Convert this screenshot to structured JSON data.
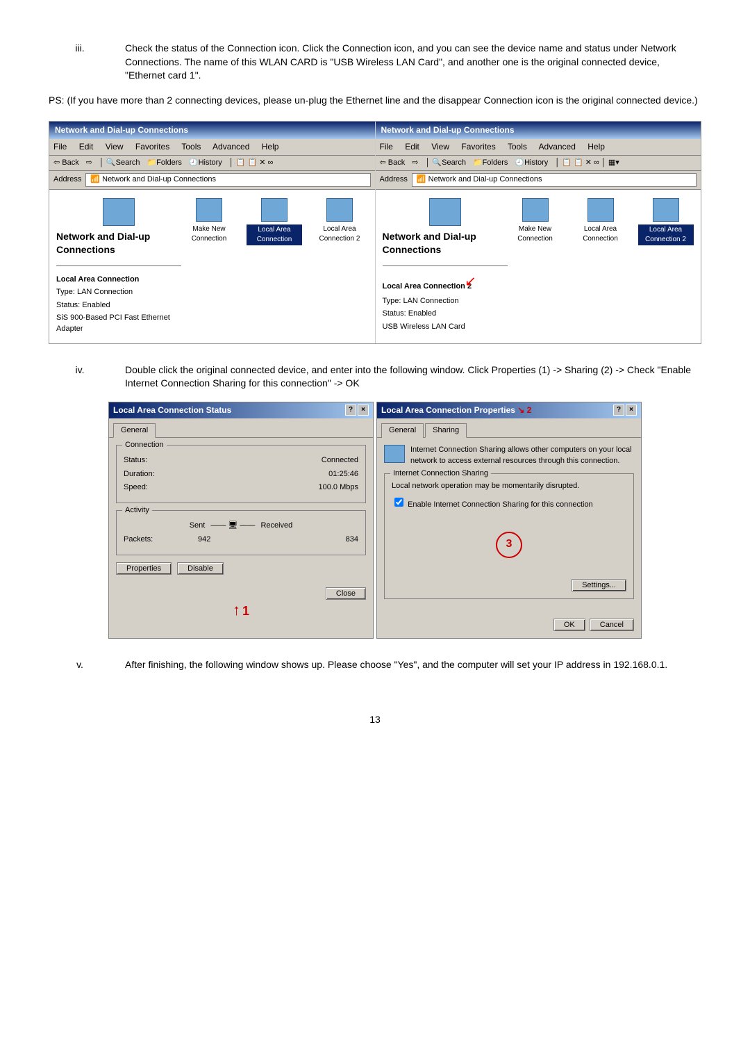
{
  "steps": {
    "iii_num": "iii.",
    "iii_text": "Check the status of the Connection icon. Click the Connection icon, and you can see the device name and status under Network Connections. The name of this WLAN CARD is \"USB Wireless LAN Card\", and another one is the original connected device, \"Ethernet card 1\".",
    "iv_num": "iv.",
    "iv_text": "Double click the original connected device, and enter into the following window. Click Properties (1) -> Sharing (2) -> Check \"Enable Internet Connection Sharing for this connection\" -> OK",
    "v_num": "v.",
    "v_text": "After finishing, the following window shows up. Please choose \"Yes\", and the computer will set your IP address in 192.168.0.1."
  },
  "ps": "PS: (If you have more than 2 connecting devices, please un-plug the Ethernet line and the disappear Connection icon is the original connected device.)",
  "explorer": {
    "title": "Network and Dial-up Connections",
    "menus": [
      "File",
      "Edit",
      "View",
      "Favorites",
      "Tools",
      "Advanced",
      "Help"
    ],
    "toolbar_back": "Back",
    "toolbar_search": "Search",
    "toolbar_folders": "Folders",
    "toolbar_history": "History",
    "address_label": "Address",
    "address_value": "Network and Dial-up Connections",
    "panel_title": "Network and Dial-up Connections",
    "icons": {
      "make_new": "Make New Connection",
      "lac": "Local Area Connection",
      "lac2": "Local Area Connection 2"
    },
    "left_info": {
      "title": "Local Area Connection",
      "type": "Type: LAN Connection",
      "status": "Status: Enabled",
      "device": "SiS 900-Based PCI Fast Ethernet Adapter"
    },
    "right_info": {
      "title": "Local Area Connection 2",
      "type": "Type: LAN Connection",
      "status": "Status: Enabled",
      "device": "USB Wireless LAN Card"
    }
  },
  "status_dlg": {
    "title": "Local Area Connection Status",
    "tab_general": "General",
    "group_connection": "Connection",
    "status_label": "Status:",
    "status_value": "Connected",
    "duration_label": "Duration:",
    "duration_value": "01:25:46",
    "speed_label": "Speed:",
    "speed_value": "100.0 Mbps",
    "group_activity": "Activity",
    "sent_label": "Sent",
    "received_label": "Received",
    "packets_label": "Packets:",
    "sent_val": "942",
    "recv_val": "834",
    "btn_properties": "Properties",
    "btn_disable": "Disable",
    "btn_close": "Close"
  },
  "props_dlg": {
    "title": "Local Area Connection Properties",
    "tab_general": "General",
    "tab_sharing": "Sharing",
    "share_desc": "Internet Connection Sharing allows other computers on your local network to access external resources through this connection.",
    "group_sharing": "Internet Connection Sharing",
    "warn": "Local network operation may be momentarily disrupted.",
    "checkbox": "Enable Internet Connection Sharing for this connection",
    "btn_settings": "Settings...",
    "btn_ok": "OK",
    "btn_cancel": "Cancel"
  },
  "annotations": {
    "one": "1",
    "two": "2",
    "three": "3"
  },
  "page_number": "13"
}
